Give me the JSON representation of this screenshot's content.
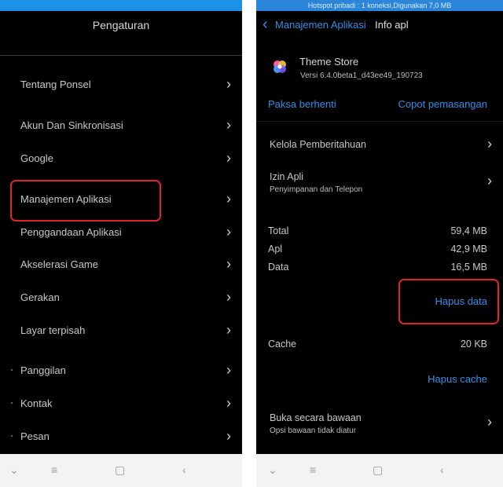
{
  "left": {
    "title": "Pengaturan",
    "items": [
      {
        "label": "Tentang Ponsel"
      },
      {
        "label": "Akun Dan Sinkronisasi"
      },
      {
        "label": "Google"
      },
      {
        "label": "Manajemen Aplikasi"
      },
      {
        "label": "Penggandaan Aplikasi"
      },
      {
        "label": "Akselerasi Game"
      },
      {
        "label": "Gerakan"
      },
      {
        "label": "Layar terpisah"
      },
      {
        "label": "Panggilan"
      },
      {
        "label": "Kontak"
      },
      {
        "label": "Pesan"
      }
    ]
  },
  "right": {
    "status_text": "Hotspot pribadi : 1 koneksi,Digunakan 7,0 MB",
    "back_label": "Manajemen Aplikasi",
    "title": "Info apl",
    "app_name": "Theme Store",
    "app_version": "Versi 6.4.0beta1_d43ee49_190723",
    "force_stop": "Paksa berhenti",
    "uninstall": "Copot pemasangan",
    "notifications": "Kelola Pemberitahuan",
    "permissions": "Izin Apli",
    "permissions_sub": "Penyimpanan dan Telepon",
    "storage": [
      {
        "label": "Total",
        "value": "59,4 MB"
      },
      {
        "label": "Apl",
        "value": "42,9 MB"
      },
      {
        "label": "Data",
        "value": "16,5 MB"
      }
    ],
    "clear_data": "Hapus data",
    "cache_label": "Cache",
    "cache_value": "20 KB",
    "clear_cache": "Hapus cache",
    "open_default": "Buka secara bawaan",
    "open_default_sub": "Opsi bawaan tidak diatur"
  },
  "colors": {
    "accent_blue": "#2f8fe8",
    "highlight_red": "#e0242e"
  },
  "icons": [
    "chevron-right-icon",
    "back-arrow-icon",
    "theme-store-app-icon",
    "nav-menu-icon",
    "nav-recents-icon",
    "nav-home-icon",
    "nav-back-icon"
  ]
}
